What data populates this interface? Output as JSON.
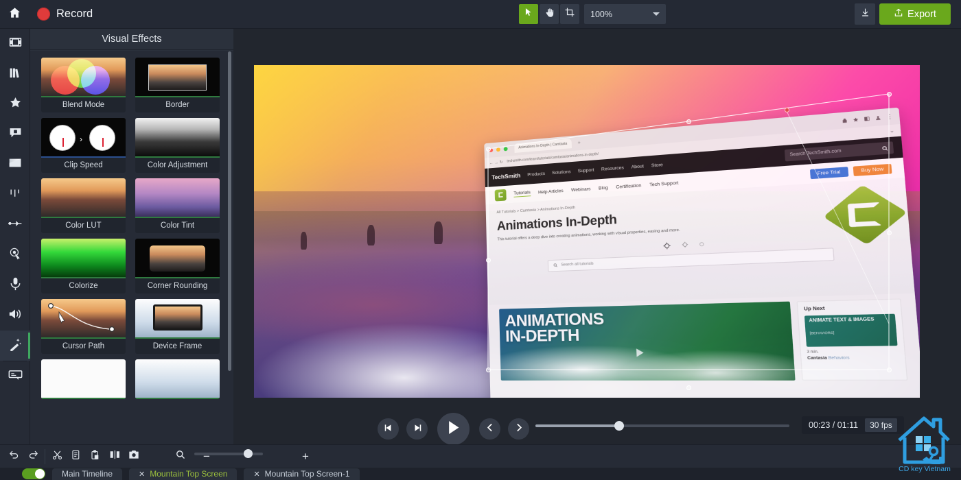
{
  "topbar": {
    "home_icon": "home-icon",
    "record_label": "Record",
    "record_icon": "record-dot-icon",
    "tools": [
      {
        "name": "select-tool",
        "icon": "cursor-arrow-icon",
        "active": true
      },
      {
        "name": "pan-tool",
        "icon": "hand-icon",
        "active": false
      },
      {
        "name": "crop-tool",
        "icon": "crop-icon",
        "active": false
      }
    ],
    "zoom_value": "100%",
    "download_icon": "download-arrow-icon",
    "export_label": "Export",
    "export_icon": "share-upload-icon",
    "accent_green": "#6aa81c"
  },
  "rail": {
    "items": [
      {
        "name": "media-bin",
        "icon": "film-strip-icon",
        "active": false
      },
      {
        "name": "library",
        "icon": "library-books-icon",
        "active": false
      },
      {
        "name": "favorites",
        "icon": "star-icon",
        "active": false
      },
      {
        "name": "annotations",
        "icon": "callout-icon",
        "active": false
      },
      {
        "name": "transitions",
        "icon": "gradient-square-icon",
        "active": false
      },
      {
        "name": "behaviors",
        "icon": "behaviors-icon",
        "active": false
      },
      {
        "name": "animations",
        "icon": "arrow-keyframe-icon",
        "active": false
      },
      {
        "name": "cursor-effects",
        "icon": "cursor-ring-icon",
        "active": false
      },
      {
        "name": "voice-narration",
        "icon": "microphone-icon",
        "active": false
      },
      {
        "name": "audio-effects",
        "icon": "speaker-icon",
        "active": false
      },
      {
        "name": "visual-effects",
        "icon": "magic-wand-icon",
        "active": true
      },
      {
        "name": "captions",
        "icon": "caption-box-icon",
        "active": false
      }
    ],
    "active_indicator_color": "#3fa860"
  },
  "panel": {
    "title": "Visual Effects",
    "effects": [
      {
        "label": "Blend Mode",
        "thumb": "blend-mode-thumb",
        "selected": false
      },
      {
        "label": "Border",
        "thumb": "border-thumb",
        "selected": false
      },
      {
        "label": "Clip Speed",
        "thumb": "clip-speed-thumb",
        "selected": true
      },
      {
        "label": "Color Adjustment",
        "thumb": "color-adjustment-thumb",
        "selected": false
      },
      {
        "label": "Color LUT",
        "thumb": "color-lut-thumb",
        "selected": false
      },
      {
        "label": "Color Tint",
        "thumb": "color-tint-thumb",
        "selected": false
      },
      {
        "label": "Colorize",
        "thumb": "colorize-thumb",
        "selected": false
      },
      {
        "label": "Corner Rounding",
        "thumb": "corner-rounding-thumb",
        "selected": false
      },
      {
        "label": "Cursor Path",
        "thumb": "cursor-path-thumb",
        "selected": false
      },
      {
        "label": "Device Frame",
        "thumb": "device-frame-thumb",
        "selected": false
      }
    ]
  },
  "canvas": {
    "browser": {
      "tab_title": "Animations In-Depth | Camtasia",
      "url": "techsmith.com/learn/tutorials/camtasia/animations-in-depth/",
      "brand": "TechSmith",
      "top_nav": [
        "Products",
        "Solutions",
        "Support",
        "Resources",
        "About",
        "Store"
      ],
      "search_placeholder": "Search TechSmith.com",
      "sub_nav": [
        "Tutorials",
        "Help Articles",
        "Webinars",
        "Blog",
        "Certification",
        "Tech Support"
      ],
      "cta_primary": "Free Trial",
      "cta_secondary": "Buy Now",
      "breadcrumb": "All Tutorials > Camtasia > Animations In-Depth",
      "heading": "Animations In-Depth",
      "description": "This tutorial offers a deep dive into creating animations, working with visual properties, easing and more.",
      "tutorial_search_placeholder": "Search all tutorials",
      "hero_title_line1": "ANIMATIONS",
      "hero_title_line2": "IN-DEPTH",
      "up_next_heading": "Up Next",
      "up_next_title": "ANIMATE TEXT & IMAGES",
      "up_next_sub": "[BEHAVIORS]",
      "up_next_duration": "3 min.",
      "up_next_course": "Cantasia",
      "up_next_course_sub": "Behaviors"
    }
  },
  "playback": {
    "prev_frame_icon": "step-back-icon",
    "next_frame_icon": "step-forward-icon",
    "play_icon": "play-icon",
    "prev_marker_icon": "chevron-left-icon",
    "next_marker_icon": "chevron-right-icon",
    "current_time": "00:23",
    "total_time": "01:11",
    "time_display": "00:23 / 01:11",
    "fps": "30 fps",
    "scrub_percent": 33
  },
  "bottom_toolbar": {
    "buttons": [
      {
        "name": "undo-button",
        "icon": "undo-arrow-icon"
      },
      {
        "name": "redo-button",
        "icon": "redo-arrow-icon"
      },
      {
        "name": "cut-button",
        "icon": "scissors-icon"
      },
      {
        "name": "copy-button",
        "icon": "copy-icon"
      },
      {
        "name": "paste-button",
        "icon": "paste-icon"
      },
      {
        "name": "split-button",
        "icon": "split-icon"
      },
      {
        "name": "snapshot-button",
        "icon": "camera-icon"
      }
    ],
    "zoom_search_icon": "magnifier-icon",
    "zoom_out_label": "−",
    "zoom_in_label": "+",
    "zoom_percent": 72
  },
  "track_tabs": {
    "toggle_on": true,
    "tabs": [
      {
        "label": "Main Timeline",
        "closable": false,
        "active": false
      },
      {
        "label": "Mountain Top Screen",
        "closable": true,
        "active": true
      },
      {
        "label": "Mountain Top Screen-1",
        "closable": true,
        "active": false
      }
    ]
  },
  "watermark": {
    "label": "CD key Vietnam",
    "color": "#3ea8e8",
    "icons": [
      "house-outline-icon",
      "windows-logo-icon",
      "hand-holding-key-icon"
    ]
  }
}
